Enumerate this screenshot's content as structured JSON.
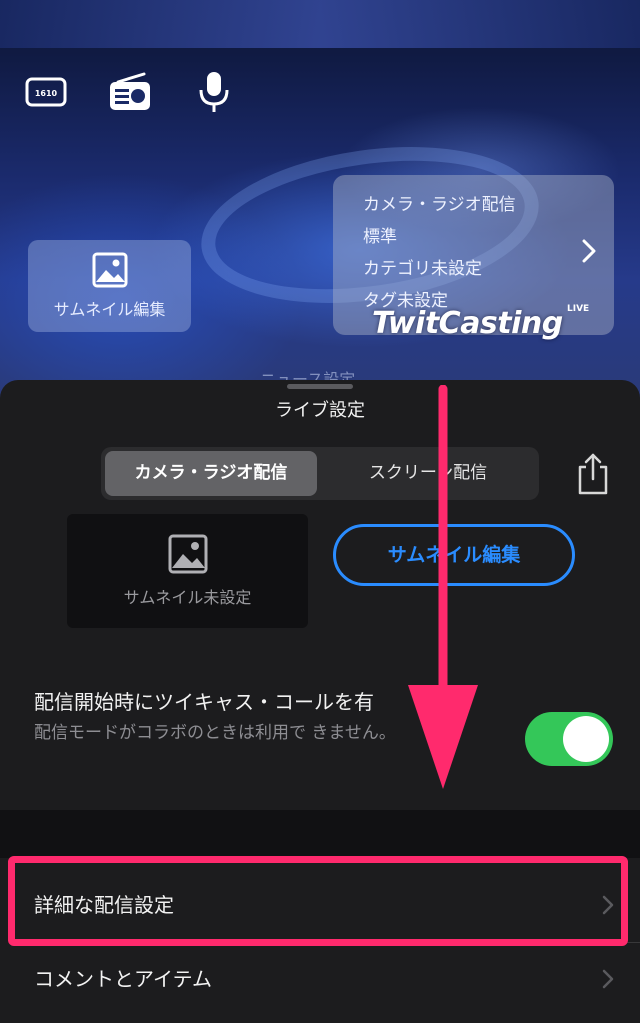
{
  "preview": {
    "thumbnail_button_label": "サムネイル編集",
    "info_card": {
      "line1": "カメラ・ラジオ配信",
      "line2": "標準",
      "line3": "カテゴリ未設定",
      "line4": "タグ未設定"
    },
    "brand_text": "TwitCasting",
    "brand_badge": "LIVE",
    "hint_text": "ニュース設定"
  },
  "sheet": {
    "title": "ライブ設定",
    "segments": [
      {
        "label": "カメラ・ラジオ配信",
        "selected": true
      },
      {
        "label": "スクリーン配信",
        "selected": false
      }
    ],
    "thumbnail_placeholder_label": "サムネイル未設定",
    "thumbnail_edit_button": "サムネイル編集",
    "call_setting": {
      "title": "配信開始時にツイキャス・コールを有",
      "subtitle": "配信モードがコラボのときは利用で きません。",
      "enabled": true
    },
    "rows": [
      {
        "label": "詳細な配信設定"
      },
      {
        "label": "コメントとアイテム"
      }
    ]
  },
  "colors": {
    "accent_blue": "#2a8cff",
    "toggle_green": "#34c759",
    "annotation_pink": "#ff2a6d",
    "sheet_bg": "#1c1c1e"
  },
  "icons": [
    "1610-icon",
    "radio-icon",
    "microphone-icon",
    "image-icon",
    "chevron-right-icon",
    "share-icon",
    "down-arrow-annotation"
  ]
}
